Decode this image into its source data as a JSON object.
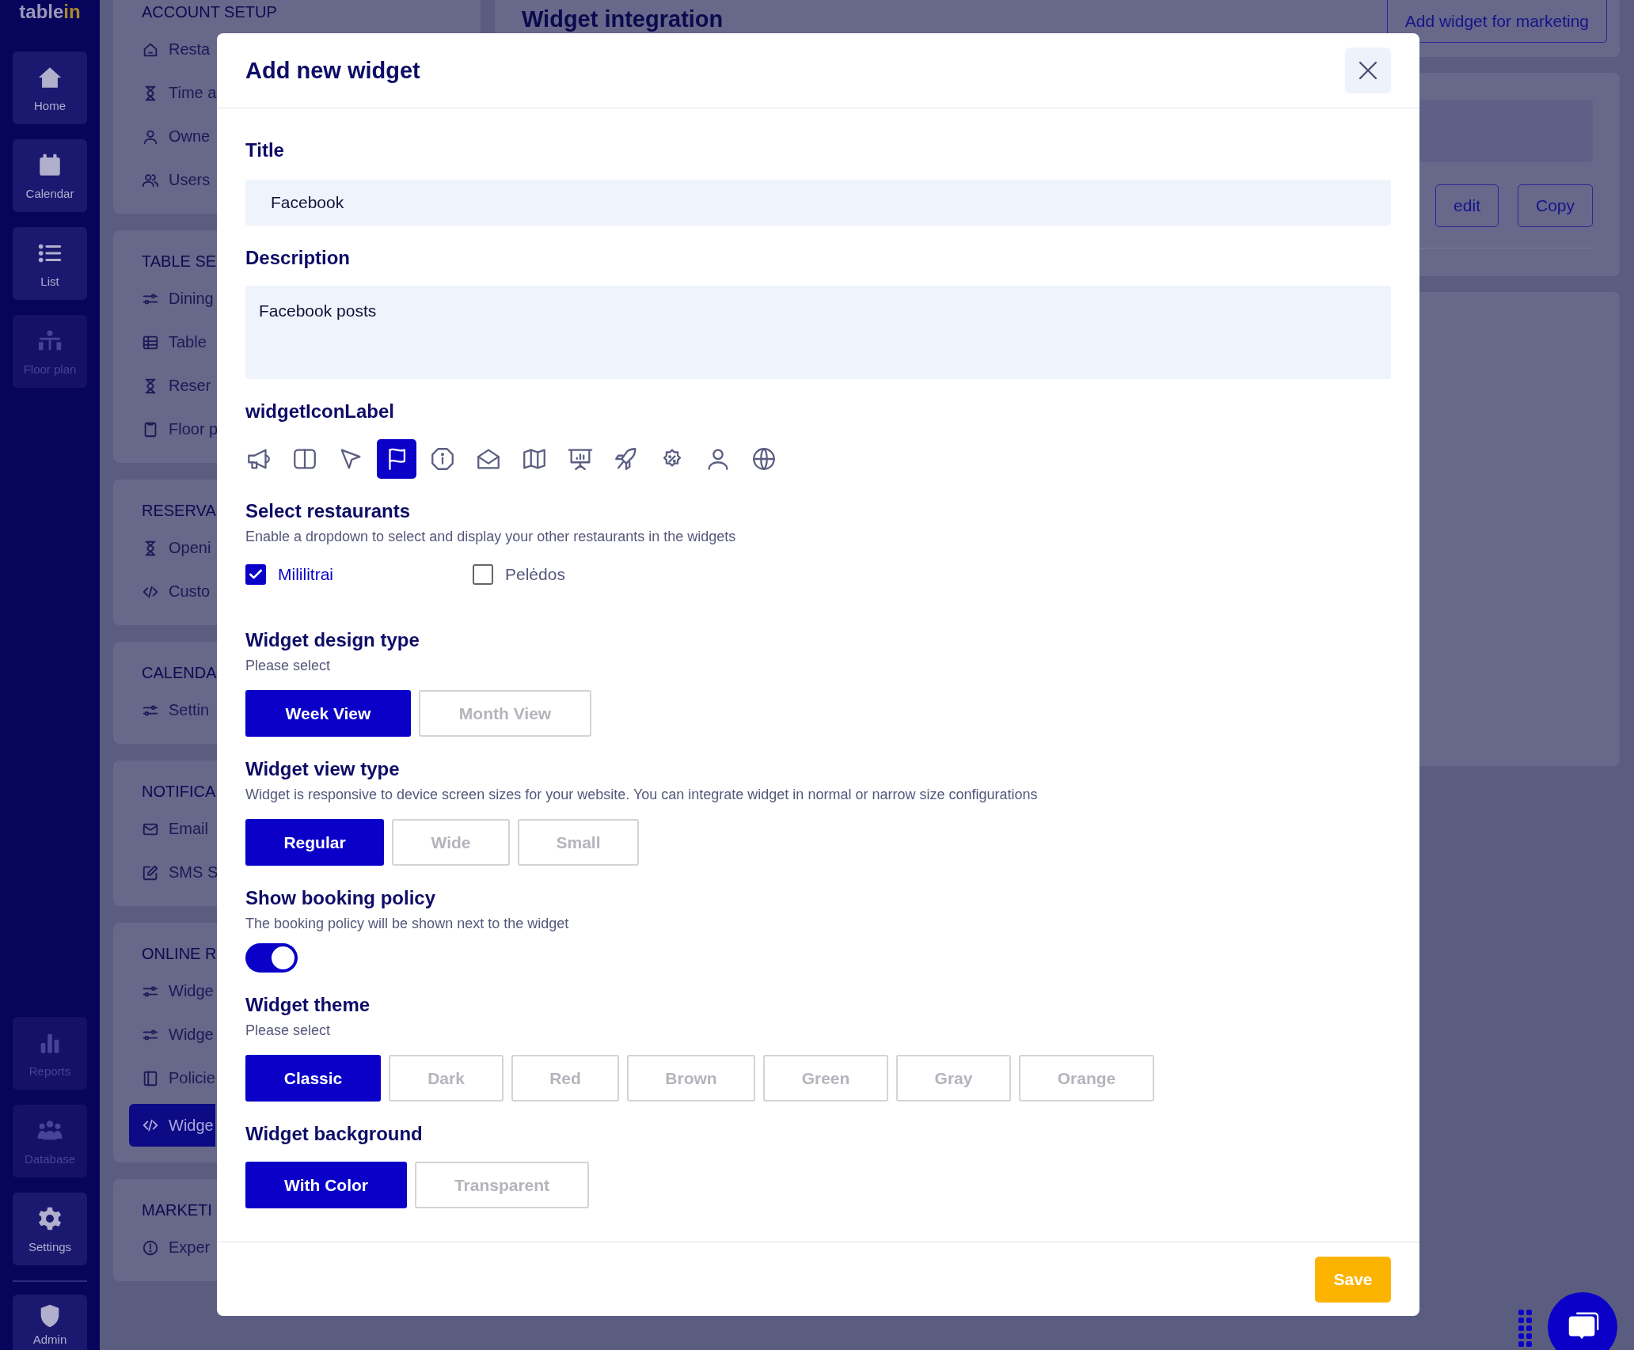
{
  "sidebar": {
    "logo_main": "table",
    "logo_accent": "in",
    "top_items": [
      {
        "label": "Home",
        "disabled": false
      },
      {
        "label": "Calendar",
        "disabled": false
      },
      {
        "label": "List",
        "disabled": false
      },
      {
        "label": "Floor plan",
        "disabled": true
      }
    ],
    "bottom_items": [
      {
        "label": "Reports",
        "disabled": true
      },
      {
        "label": "Database",
        "disabled": true
      },
      {
        "label": "Settings",
        "disabled": false
      }
    ],
    "footer_item": {
      "label": "Admin",
      "disabled": false
    }
  },
  "settings_menu": [
    {
      "heading": "ACCOUNT SETUP",
      "items": [
        {
          "label": "Resta",
          "selected": false
        },
        {
          "label": "Time a",
          "selected": false
        },
        {
          "label": "Owne",
          "selected": false
        },
        {
          "label": "Users",
          "selected": false
        }
      ]
    },
    {
      "heading": "TABLE SE",
      "items": [
        {
          "label": "Dining",
          "selected": false
        },
        {
          "label": "Table",
          "selected": false
        },
        {
          "label": "Reser",
          "selected": false
        },
        {
          "label": "Floor p",
          "selected": false
        }
      ]
    },
    {
      "heading": "RESERVA",
      "items": [
        {
          "label": "Openi",
          "selected": false
        },
        {
          "label": "Custo",
          "selected": false
        }
      ]
    },
    {
      "heading": "CALENDA",
      "items": [
        {
          "label": "Settin",
          "selected": false
        }
      ]
    },
    {
      "heading": "NOTIFICA",
      "items": [
        {
          "label": "Email",
          "selected": false
        },
        {
          "label": "SMS S",
          "selected": false
        }
      ]
    },
    {
      "heading": "ONLINE R",
      "items": [
        {
          "label": "Widge",
          "selected": false
        },
        {
          "label": "Widge",
          "selected": false
        },
        {
          "label": "Policie",
          "selected": false
        },
        {
          "label": "Widge",
          "selected": true
        }
      ]
    },
    {
      "heading": "MARKETI",
      "items": [
        {
          "label": "Exper",
          "selected": false
        }
      ]
    }
  ],
  "main": {
    "title": "Widget integration",
    "marketing_button": "Add widget for marketing",
    "edit_button": "edit",
    "copy_button": "Copy"
  },
  "modal": {
    "title": "Add new widget",
    "title_field": {
      "label": "Title",
      "value": "Facebook"
    },
    "description_field": {
      "label": "Description",
      "value": "Facebook posts"
    },
    "icon_picker": {
      "label": "widgetIconLabel",
      "icons": [
        {
          "kind": "megaphone",
          "selected": false
        },
        {
          "kind": "columns",
          "selected": false
        },
        {
          "kind": "pointer",
          "selected": false
        },
        {
          "kind": "flag",
          "selected": true
        },
        {
          "kind": "info",
          "selected": false
        },
        {
          "kind": "envelope",
          "selected": false
        },
        {
          "kind": "map",
          "selected": false
        },
        {
          "kind": "presentation",
          "selected": false
        },
        {
          "kind": "rocket",
          "selected": false
        },
        {
          "kind": "discount",
          "selected": false
        },
        {
          "kind": "user",
          "selected": false
        },
        {
          "kind": "globe",
          "selected": false
        }
      ]
    },
    "restaurants": {
      "label": "Select restaurants",
      "hint": "Enable a dropdown to select and display your other restaurants in the widgets",
      "options": [
        {
          "label": "Mililitrai",
          "checked": true
        },
        {
          "label": "Pelėdos",
          "checked": false
        }
      ]
    },
    "design_type": {
      "label": "Widget design type",
      "hint": "Please select",
      "options": [
        {
          "label": "Week View",
          "selected": true
        },
        {
          "label": "Month View",
          "selected": false
        }
      ]
    },
    "view_type": {
      "label": "Widget view type",
      "hint": "Widget is responsive to device screen sizes for your website. You can integrate widget in normal or narrow size configurations",
      "options": [
        {
          "label": "Regular",
          "selected": true
        },
        {
          "label": "Wide",
          "selected": false
        },
        {
          "label": "Small",
          "selected": false
        }
      ]
    },
    "booking_policy": {
      "label": "Show booking policy",
      "hint": "The booking policy will be shown next to the widget",
      "on": true
    },
    "theme": {
      "label": "Widget theme",
      "hint": "Please select",
      "options": [
        {
          "label": "Classic",
          "selected": true
        },
        {
          "label": "Dark",
          "selected": false
        },
        {
          "label": "Red",
          "selected": false
        },
        {
          "label": "Brown",
          "selected": false
        },
        {
          "label": "Green",
          "selected": false
        },
        {
          "label": "Gray",
          "selected": false
        },
        {
          "label": "Orange",
          "selected": false
        }
      ]
    },
    "background": {
      "label": "Widget background",
      "options": [
        {
          "label": "With Color",
          "selected": true
        },
        {
          "label": "Transparent",
          "selected": false
        }
      ]
    },
    "save_button": "Save"
  }
}
